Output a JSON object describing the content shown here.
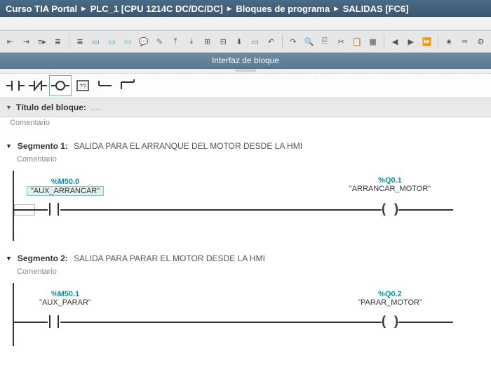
{
  "breadcrumb": [
    "Curso TIA Portal",
    "PLC_1 [CPU 1214C DC/DC/DC]",
    "Bloques de programa",
    "SALIDAS [FC6]"
  ],
  "interface_bar": "Interfaz de bloque",
  "block_title_label": "Título del bloque:",
  "block_title_value": ".....",
  "block_comment": "Comentario",
  "segments": [
    {
      "name": "Segmento 1:",
      "title": "SALIDA PARA EL ARRANQUE DEL MOTOR DESDE LA HMI",
      "comment": "Comentario",
      "contact": {
        "addr": "%M50.0",
        "sym": "\"AUX_ARRANCAR\""
      },
      "coil": {
        "addr": "%Q0.1",
        "sym": "\"ARRANCAR_MOTOR\""
      }
    },
    {
      "name": "Segmento 2:",
      "title": "SALIDA PARA PARAR EL MOTOR DESDE LA HMI",
      "comment": "Comentario",
      "contact": {
        "addr": "%M50.1",
        "sym": "\"AUX_PARAR\""
      },
      "coil": {
        "addr": "%Q0.2",
        "sym": "\"PARAR_MOTOR\""
      }
    }
  ],
  "toolbar_icons": [
    "go-start",
    "go-end",
    "step",
    "filter",
    "list",
    "seg-blue",
    "seg-cyan",
    "seg-green",
    "comment-toggle",
    "ref",
    "insert-up",
    "insert-down",
    "tag",
    "tag-db",
    "arrow-down",
    "undo",
    "redo",
    "find",
    "copy",
    "cut",
    "paste",
    "db",
    "db2",
    "db3",
    "nav-left",
    "nav-right",
    "nav-jump",
    "favorite",
    "compare",
    "settings"
  ],
  "palette_items": [
    "open-contact",
    "closed-contact",
    "coil",
    "box",
    "branch-right",
    "branch-down"
  ]
}
